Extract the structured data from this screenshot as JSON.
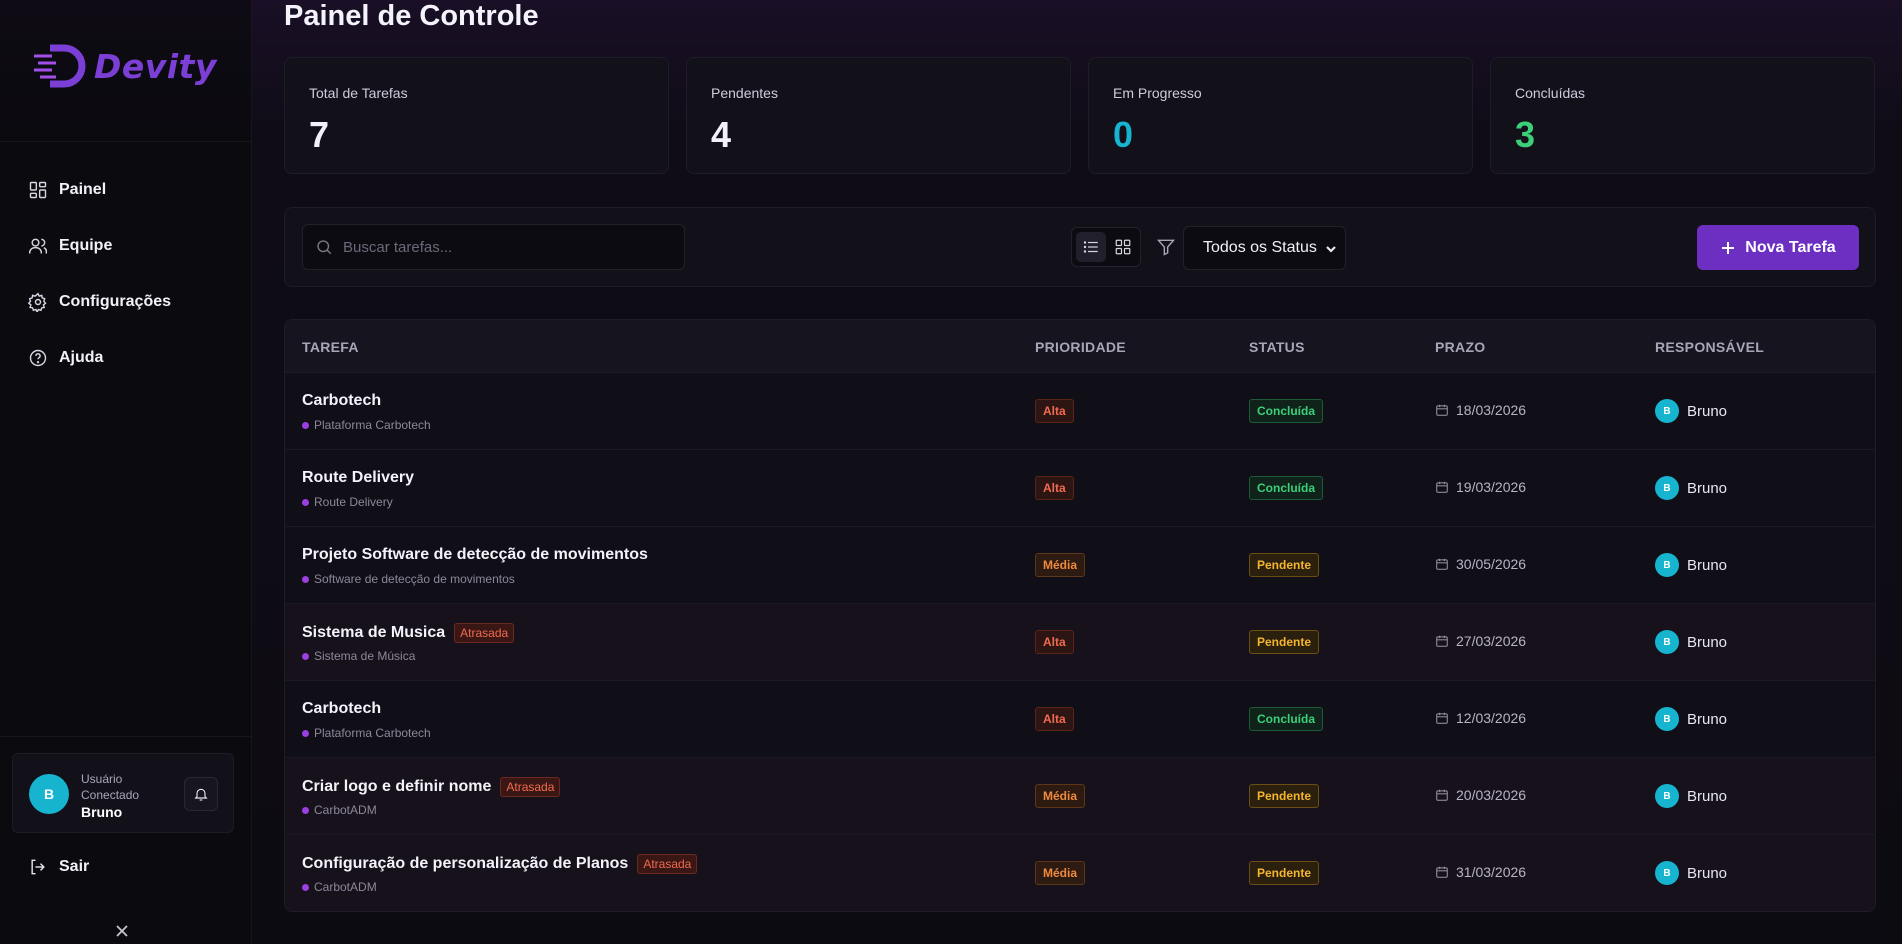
{
  "brand": {
    "name": "Devity",
    "color": "#7b3fd6"
  },
  "sidebar": {
    "items": [
      {
        "label": "Painel",
        "icon": "dashboard-icon"
      },
      {
        "label": "Equipe",
        "icon": "users-icon"
      },
      {
        "label": "Configurações",
        "icon": "gear-icon"
      },
      {
        "label": "Ajuda",
        "icon": "help-icon"
      }
    ],
    "user": {
      "initial": "B",
      "label": "Usuário Conectado",
      "name": "Bruno"
    },
    "logout_label": "Sair"
  },
  "page_title": "Painel de Controle",
  "stats": [
    {
      "label": "Total de Tarefas",
      "value": "7",
      "color": "#f2f0f8"
    },
    {
      "label": "Pendentes",
      "value": "4",
      "color": "#f2f0f8"
    },
    {
      "label": "Em Progresso",
      "value": "0",
      "color": "#17b4d0"
    },
    {
      "label": "Concluídas",
      "value": "3",
      "color": "#3ccf7a"
    }
  ],
  "toolbar": {
    "search_placeholder": "Buscar tarefas...",
    "status_filter": "Todos os Status",
    "new_task_label": "Nova Tarefa",
    "accent": "#6d2fc2"
  },
  "table": {
    "headers": [
      "TAREFA",
      "PRIORIDADE",
      "STATUS",
      "PRAZO",
      "RESPONSÁVEL"
    ],
    "rows": [
      {
        "title": "Carbotech",
        "project": "Plataforma Carbotech",
        "late": "",
        "priority": "Alta",
        "status": "Concluída",
        "due": "18/03/2026",
        "assignee": "Bruno",
        "initial": "B"
      },
      {
        "title": "Route Delivery",
        "project": "Route Delivery",
        "late": "",
        "priority": "Alta",
        "status": "Concluída",
        "due": "19/03/2026",
        "assignee": "Bruno",
        "initial": "B"
      },
      {
        "title": "Projeto Software de detecção de movimentos",
        "project": "Software de detecção de movimentos",
        "late": "",
        "priority": "Média",
        "status": "Pendente",
        "due": "30/05/2026",
        "assignee": "Bruno",
        "initial": "B"
      },
      {
        "title": "Sistema de Musica",
        "project": "Sistema de Música",
        "late": "Atrasada",
        "priority": "Alta",
        "status": "Pendente",
        "due": "27/03/2026",
        "assignee": "Bruno",
        "initial": "B"
      },
      {
        "title": "Carbotech",
        "project": "Plataforma Carbotech",
        "late": "",
        "priority": "Alta",
        "status": "Concluída",
        "due": "12/03/2026",
        "assignee": "Bruno",
        "initial": "B"
      },
      {
        "title": "Criar logo e definir nome",
        "project": "CarbotADM",
        "late": "Atrasada",
        "priority": "Média",
        "status": "Pendente",
        "due": "20/03/2026",
        "assignee": "Bruno",
        "initial": "B"
      },
      {
        "title": "Configuração de personalização de Planos",
        "project": "CarbotADM",
        "late": "Atrasada",
        "priority": "Média",
        "status": "Pendente",
        "due": "31/03/2026",
        "assignee": "Bruno",
        "initial": "B"
      }
    ]
  }
}
